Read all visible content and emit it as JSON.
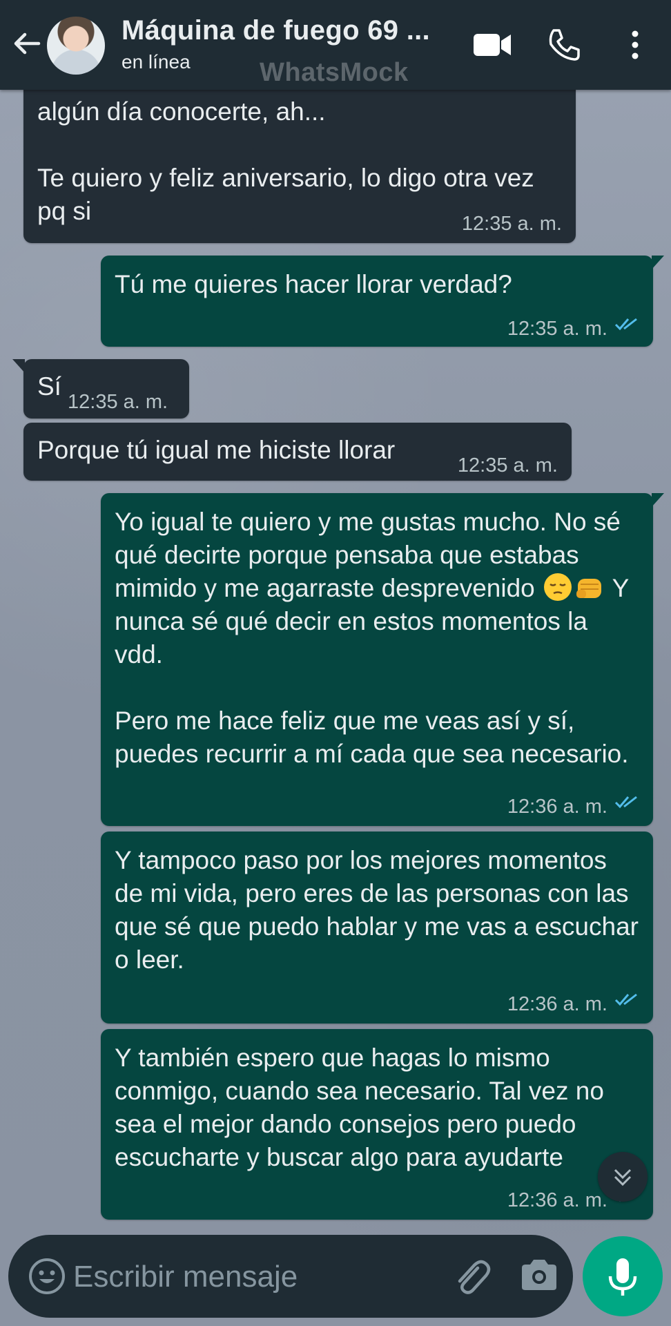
{
  "colors": {
    "header_bg": "#1f2c34",
    "incoming_bubble": "#232d36",
    "outgoing_bubble": "#054640",
    "read_ticks": "#53bdeb",
    "mic_button": "#00a884"
  },
  "header": {
    "contact_name": "Máquina de fuego 69 ...",
    "status": "en línea",
    "watermark": "WhatsMock",
    "icons": [
      "back-arrow-icon",
      "video-call-icon",
      "voice-call-icon",
      "more-options-icon"
    ]
  },
  "messages": [
    {
      "direction": "in",
      "text": "algún día conocerte, ah...\n\nTe quiero y feliz aniversario, lo digo otra vez pq si",
      "time": "12:35 a. m."
    },
    {
      "direction": "out",
      "text": "Tú me quieres hacer llorar verdad?",
      "time": "12:35 a. m.",
      "status": "read"
    },
    {
      "direction": "in",
      "text": "Sí",
      "time": "12:35 a. m."
    },
    {
      "direction": "in",
      "text": "Porque tú igual me hiciste llorar",
      "time": "12:35 a. m."
    },
    {
      "direction": "out",
      "text_before_emoji": "Yo igual te quiero y me gustas mucho. No sé qué decirte porque pensaba que estabas mimido y me agarraste desprevenido ",
      "emojis": [
        "pensive-face-emoji",
        "oncoming-fist-emoji"
      ],
      "text_after_emoji": " Y nunca sé qué decir en estos momentos la vdd.\n\nPero me hace feliz que me veas así y sí, puedes recurrir a mí cada que sea necesario.",
      "time": "12:36 a. m.",
      "status": "read"
    },
    {
      "direction": "out",
      "text": "Y tampoco paso por los mejores momentos de mi vida, pero eres de las personas con las que sé que puedo hablar y me vas a escuchar o leer.",
      "time": "12:36 a. m.",
      "status": "read"
    },
    {
      "direction": "out",
      "text": "Y también espero que hagas lo mismo conmigo, cuando sea necesario. Tal vez no sea el mejor dando consejos pero puedo escucharte y buscar algo para ayudarte",
      "time": "12:36 a. m.",
      "status": "read"
    }
  ],
  "composer": {
    "placeholder": "Escribir mensaje",
    "icons": [
      "emoji-icon",
      "attach-icon",
      "camera-icon",
      "mic-icon"
    ]
  }
}
